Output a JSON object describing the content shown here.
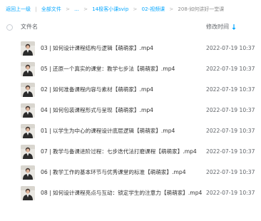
{
  "breadcrumb": {
    "back": "返回上一级",
    "all_files": "全部文件",
    "ellipsis": "...",
    "folder1": "14极客小课svip",
    "folder2": "02-视频课",
    "current": "208-如何讲好一堂课",
    "separator": "|",
    "arrow": ">"
  },
  "header": {
    "name_label": "文件名",
    "time_label": "修改时间"
  },
  "files": [
    {
      "name": "03 | 如何设计课程结构与逻辑【萌萌家】.mp4",
      "time": "2022-07-19 10:37"
    },
    {
      "name": "05 | 还原一个真实的课堂：教学七步法【萌萌家】.mp4",
      "time": "2022-07-19 10:37"
    },
    {
      "name": "02 | 如何准备课程内容与素材【萌萌家】.mp4",
      "time": "2022-07-19 10:37"
    },
    {
      "name": "04 | 如何包装课程形式与呈现【萌萌家】.mp4",
      "time": "2022-07-19 10:37"
    },
    {
      "name": "01 | 以学生为中心的课程设计底层逻辑【萌萌家】.mp4",
      "time": "2022-07-19 10:37"
    },
    {
      "name": "07 | 教学与备课进阶过程：七步迭代法打磨课程【萌萌家】.mp4",
      "time": "2022-07-19 10:37"
    },
    {
      "name": "06 | 教学工作的基本环节与优秀课堂的标准【萌萌家】.mp4",
      "time": "2022-07-19 10:37"
    },
    {
      "name": "08 | 如何设计课程亮点与互动：锁定学生的注意力【萌萌家】.mp4",
      "time": "2022-07-19 10:37"
    }
  ],
  "colors": {
    "link": "#06a7ff",
    "sort_icon": "#06a7ff"
  }
}
